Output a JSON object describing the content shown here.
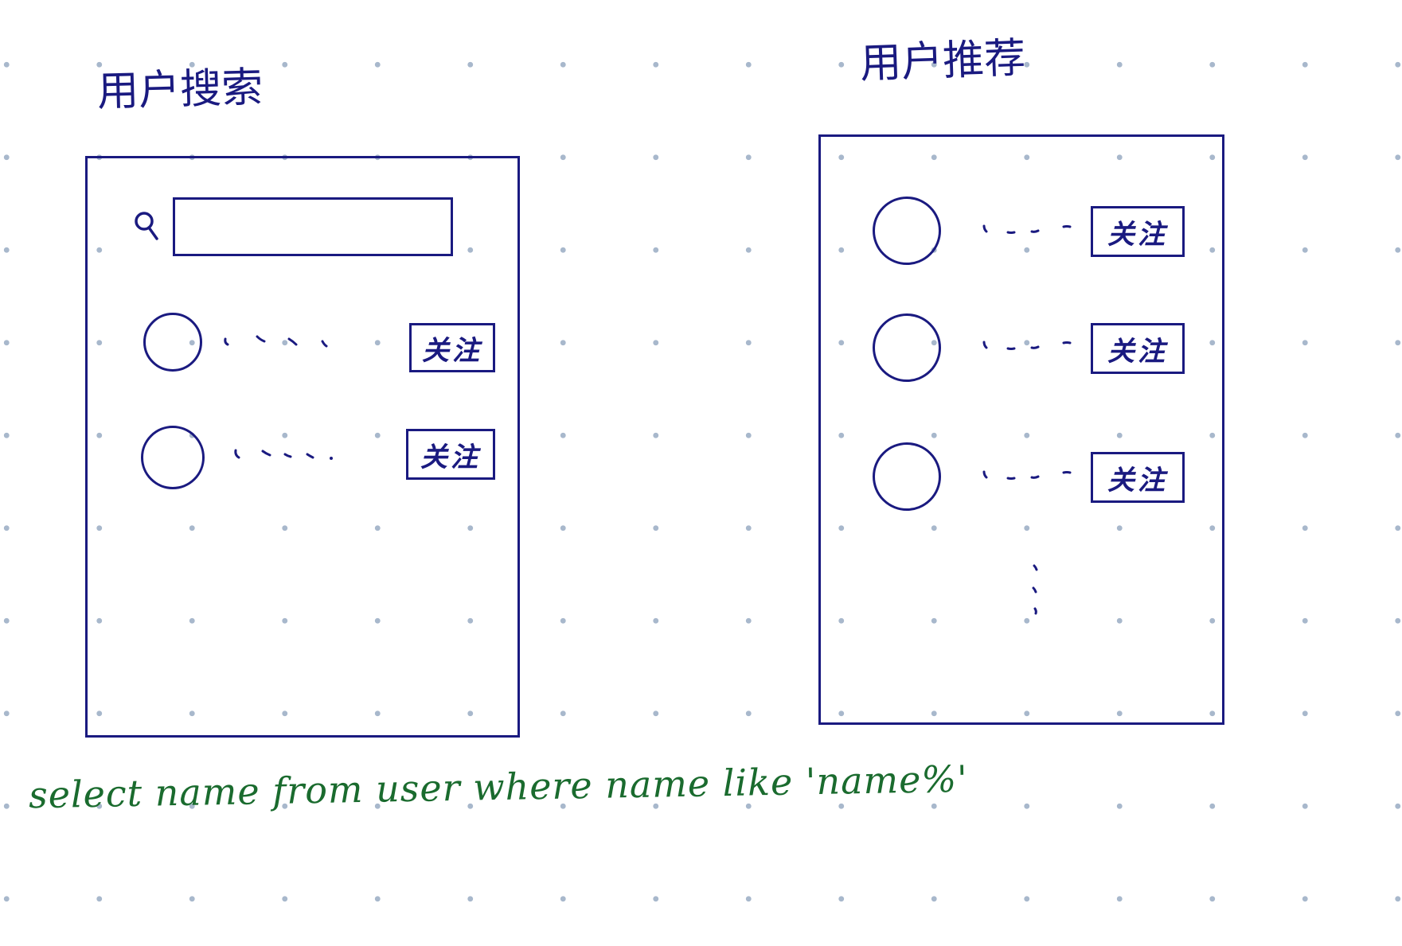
{
  "search_panel": {
    "title": "用户搜索",
    "search_input": {
      "value": "",
      "placeholder": ""
    },
    "results": [
      {
        "follow_label": "关注"
      },
      {
        "follow_label": "关注"
      }
    ]
  },
  "recommend_panel": {
    "title": "用户推荐",
    "items": [
      {
        "follow_label": "关注"
      },
      {
        "follow_label": "关注"
      },
      {
        "follow_label": "关注"
      }
    ]
  },
  "sql_note": "select name from user where name like 'name%'",
  "colors": {
    "ink": "#1a1a80",
    "sql_ink": "#1a6b2e",
    "grid_dot": "#a8b8cc"
  },
  "icons": {
    "search": "magnifier-icon",
    "more": "vertical-ellipsis-icon"
  }
}
